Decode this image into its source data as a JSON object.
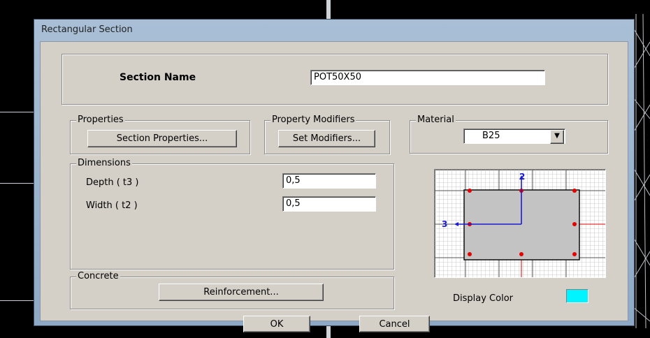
{
  "window": {
    "title": "Rectangular Section"
  },
  "section_name": {
    "label": "Section Name",
    "value": "POT50X50"
  },
  "properties": {
    "group_label": "Properties",
    "button": "Section Properties..."
  },
  "modifiers": {
    "group_label": "Property Modifiers",
    "button": "Set Modifiers..."
  },
  "material": {
    "group_label": "Material",
    "selected": "B25"
  },
  "dimensions": {
    "group_label": "Dimensions",
    "depth": {
      "label": "Depth  ( t3 )",
      "value": "0,5"
    },
    "width": {
      "label": "Width  ( t2 )",
      "value": "0,5"
    }
  },
  "concrete": {
    "group_label": "Concrete",
    "button": "Reinforcement..."
  },
  "preview": {
    "axis_2": "2",
    "axis_3": "3"
  },
  "display_color": {
    "label": "Display Color",
    "color": "#00f4ff"
  },
  "actions": {
    "ok": "OK",
    "cancel": "Cancel"
  },
  "colors": {
    "section_fill": "#c3c3c3",
    "rebar": "#e60000",
    "axis": "#1a1ad0"
  }
}
